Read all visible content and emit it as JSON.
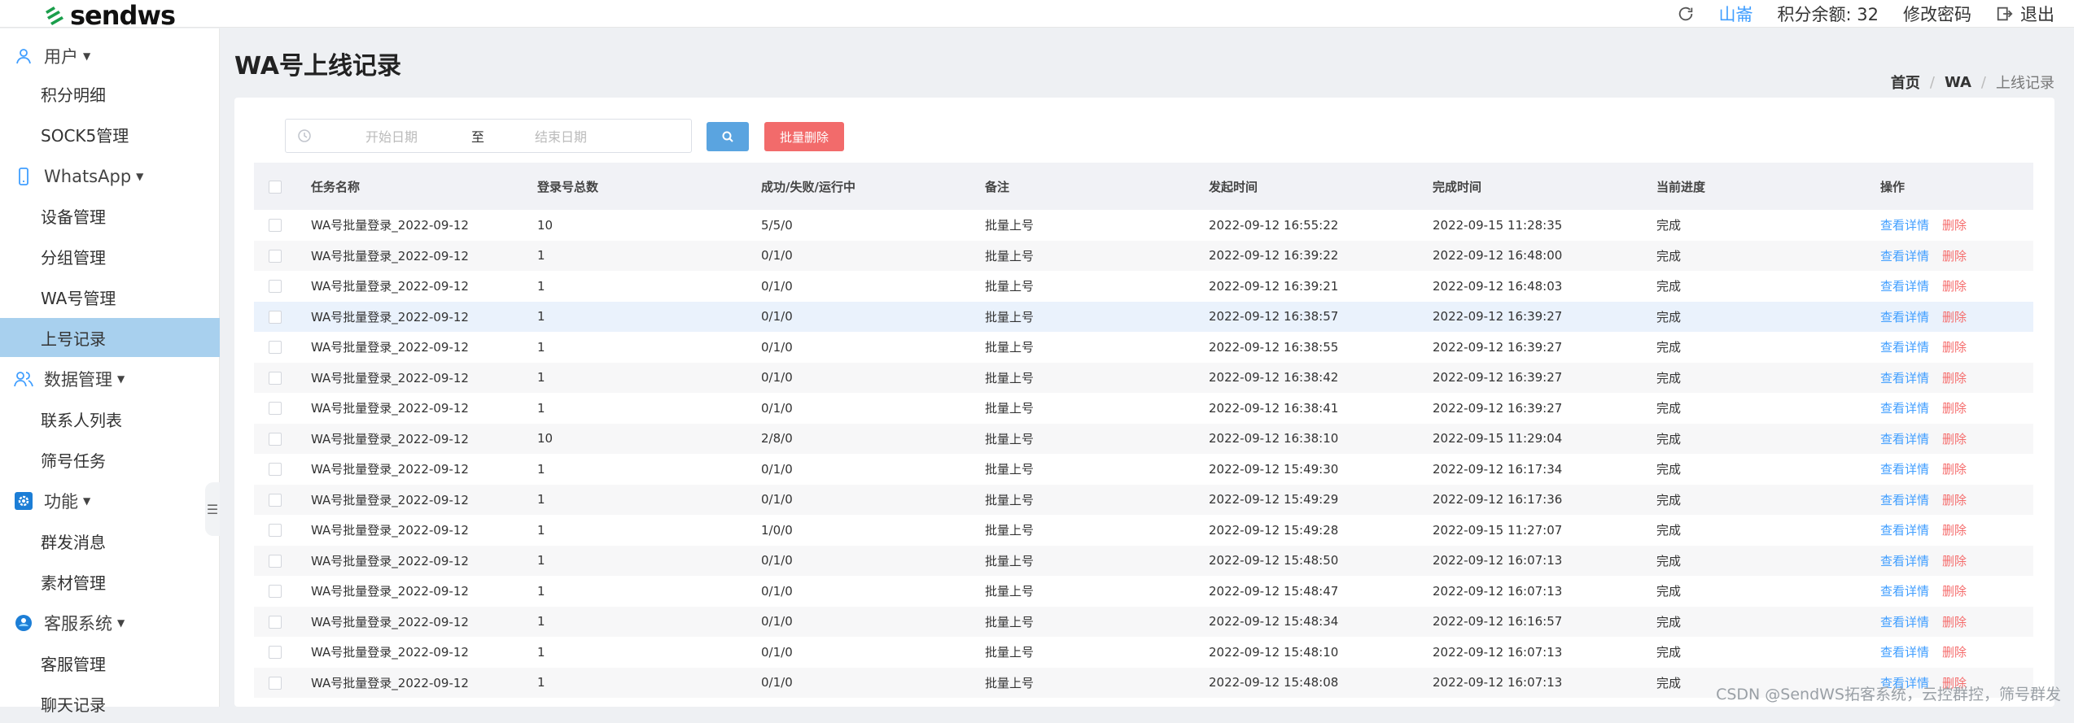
{
  "brand": {
    "name": "sendws"
  },
  "topbar": {
    "user": "山崙",
    "points": "积分余额: 32",
    "change_password": "修改密码",
    "logout": "退出"
  },
  "sidebar": {
    "groups": [
      {
        "label": "用户",
        "icon": "user-icon",
        "items": [
          "积分明细",
          "SOCK5管理"
        ]
      },
      {
        "label": "WhatsApp",
        "icon": "phone-icon",
        "items": [
          "设备管理",
          "分组管理",
          "WA号管理",
          "上号记录"
        ]
      },
      {
        "label": "数据管理",
        "icon": "users-icon",
        "items": [
          "联系人列表",
          "筛号任务"
        ]
      },
      {
        "label": "功能",
        "icon": "gear-icon",
        "items": [
          "群发消息",
          "素材管理"
        ]
      },
      {
        "label": "客服系统",
        "icon": "support-icon",
        "items": [
          "客服管理",
          "聊天记录"
        ]
      }
    ],
    "active_item": "上号记录"
  },
  "page": {
    "title": "WA号上线记录",
    "breadcrumb": [
      "首页",
      "WA",
      "上线记录"
    ]
  },
  "filter": {
    "start_placeholder": "开始日期",
    "separator": "至",
    "end_placeholder": "结束日期",
    "bulk_delete": "批量删除"
  },
  "table": {
    "columns": [
      "任务名称",
      "登录号总数",
      "成功/失败/运行中",
      "备注",
      "发起时间",
      "完成时间",
      "当前进度",
      "操作"
    ],
    "action_view": "查看详情",
    "action_delete": "删除",
    "rows": [
      [
        "WA号批量登录_2022-09-12",
        "10",
        "5/5/0",
        "批量上号",
        "2022-09-12 16:55:22",
        "2022-09-15 11:28:35",
        "完成"
      ],
      [
        "WA号批量登录_2022-09-12",
        "1",
        "0/1/0",
        "批量上号",
        "2022-09-12 16:39:22",
        "2022-09-12 16:48:00",
        "完成"
      ],
      [
        "WA号批量登录_2022-09-12",
        "1",
        "0/1/0",
        "批量上号",
        "2022-09-12 16:39:21",
        "2022-09-12 16:48:03",
        "完成"
      ],
      [
        "WA号批量登录_2022-09-12",
        "1",
        "0/1/0",
        "批量上号",
        "2022-09-12 16:38:57",
        "2022-09-12 16:39:27",
        "完成"
      ],
      [
        "WA号批量登录_2022-09-12",
        "1",
        "0/1/0",
        "批量上号",
        "2022-09-12 16:38:55",
        "2022-09-12 16:39:27",
        "完成"
      ],
      [
        "WA号批量登录_2022-09-12",
        "1",
        "0/1/0",
        "批量上号",
        "2022-09-12 16:38:42",
        "2022-09-12 16:39:27",
        "完成"
      ],
      [
        "WA号批量登录_2022-09-12",
        "1",
        "0/1/0",
        "批量上号",
        "2022-09-12 16:38:41",
        "2022-09-12 16:39:27",
        "完成"
      ],
      [
        "WA号批量登录_2022-09-12",
        "10",
        "2/8/0",
        "批量上号",
        "2022-09-12 16:38:10",
        "2022-09-15 11:29:04",
        "完成"
      ],
      [
        "WA号批量登录_2022-09-12",
        "1",
        "0/1/0",
        "批量上号",
        "2022-09-12 15:49:30",
        "2022-09-12 16:17:34",
        "完成"
      ],
      [
        "WA号批量登录_2022-09-12",
        "1",
        "0/1/0",
        "批量上号",
        "2022-09-12 15:49:29",
        "2022-09-12 16:17:36",
        "完成"
      ],
      [
        "WA号批量登录_2022-09-12",
        "1",
        "1/0/0",
        "批量上号",
        "2022-09-12 15:49:28",
        "2022-09-15 11:27:07",
        "完成"
      ],
      [
        "WA号批量登录_2022-09-12",
        "1",
        "0/1/0",
        "批量上号",
        "2022-09-12 15:48:50",
        "2022-09-12 16:07:13",
        "完成"
      ],
      [
        "WA号批量登录_2022-09-12",
        "1",
        "0/1/0",
        "批量上号",
        "2022-09-12 15:48:47",
        "2022-09-12 16:07:13",
        "完成"
      ],
      [
        "WA号批量登录_2022-09-12",
        "1",
        "0/1/0",
        "批量上号",
        "2022-09-12 15:48:34",
        "2022-09-12 16:16:57",
        "完成"
      ],
      [
        "WA号批量登录_2022-09-12",
        "1",
        "0/1/0",
        "批量上号",
        "2022-09-12 15:48:10",
        "2022-09-12 16:07:13",
        "完成"
      ],
      [
        "WA号批量登录_2022-09-12",
        "1",
        "0/1/0",
        "批量上号",
        "2022-09-12 15:48:08",
        "2022-09-12 16:07:13",
        "完成"
      ]
    ]
  },
  "watermark": "CSDN @SendWS拓客系统，云控群控，筛号群发",
  "colors": {
    "primary": "#409eff",
    "danger": "#f56c6c",
    "active_menu": "#a8d0ee"
  }
}
